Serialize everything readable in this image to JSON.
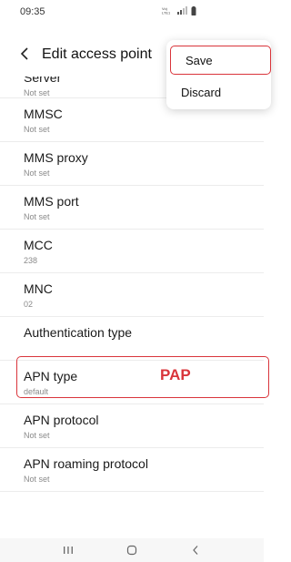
{
  "status_bar": {
    "time": "09:35",
    "icons": [
      "volte-icon",
      "signal-icon",
      "battery-icon"
    ],
    "volte_text": "Vo)\nLTE1"
  },
  "header": {
    "back_icon": "chevron-left-icon",
    "title": "Edit access point"
  },
  "menu": {
    "items": [
      {
        "label": "Save"
      },
      {
        "label": "Discard"
      }
    ]
  },
  "settings": [
    {
      "label": "Server",
      "value": "Not set"
    },
    {
      "label": "MMSC",
      "value": "Not set"
    },
    {
      "label": "MMS proxy",
      "value": "Not set"
    },
    {
      "label": "MMS port",
      "value": "Not set"
    },
    {
      "label": "MCC",
      "value": "238"
    },
    {
      "label": "MNC",
      "value": "02"
    },
    {
      "label": "Authentication type",
      "value": ""
    },
    {
      "label": "APN type",
      "value": "default"
    },
    {
      "label": "APN protocol",
      "value": "Not set"
    },
    {
      "label": "APN roaming protocol",
      "value": "Not set"
    }
  ],
  "annotation": {
    "text": "PAP",
    "color": "#d9353b"
  },
  "nav_bar": {
    "icons": [
      "recents-icon",
      "home-icon",
      "back-icon"
    ]
  }
}
